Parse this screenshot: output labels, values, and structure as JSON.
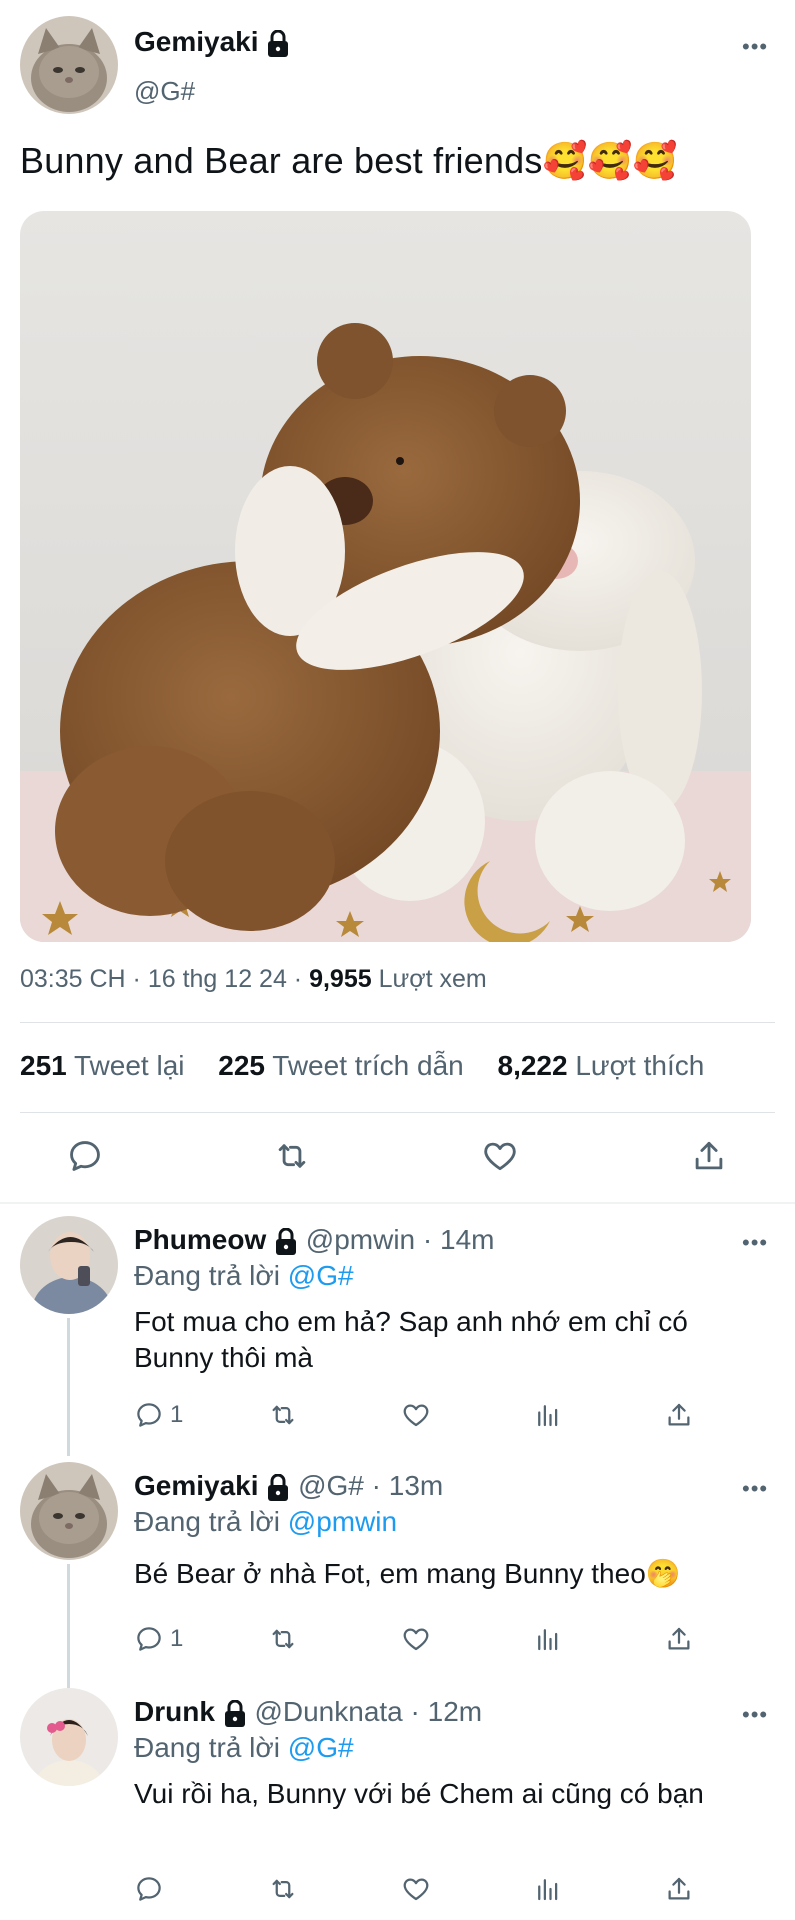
{
  "tweet": {
    "author_name": "Gemiyaki",
    "author_handle": "@G#",
    "text": "Bunny and Bear are best friends🥰🥰🥰",
    "time": "03:35 CH · 16 thg 12 24 · ",
    "views_count": "9,955",
    "views_label": " Lượt xem",
    "stats": {
      "retweets_count": "251",
      "retweets_label": "Tweet lại",
      "quotes_count": "225",
      "quotes_label": "Tweet trích dẫn",
      "likes_count": "8,222",
      "likes_label": "Lượt thích"
    },
    "media_icon": "photo-teddy-bear-hugging-bunny"
  },
  "replies": [
    {
      "author_name": "Phumeow",
      "author_handle": "@pmwin",
      "time": " · 14m",
      "replying_prefix": "Đang trả lời ",
      "replying_to": "@G#",
      "text": "Fot mua cho em hả? Sap anh nhớ em chỉ có Bunny thôi mà",
      "reply_count": "1"
    },
    {
      "author_name": "Gemiyaki",
      "author_handle": "@G#",
      "time": " · 13m",
      "replying_prefix": "Đang trả lời ",
      "replying_to": "@pmwin",
      "text": "Bé Bear ở nhà Fot, em mang Bunny theo🤭",
      "reply_count": "1"
    },
    {
      "author_name": "Drunk",
      "author_handle": "@Dunknata",
      "time": " · 12m",
      "replying_prefix": "Đang trả lời ",
      "replying_to": "@G#",
      "text": "Vui rồi ha, Bunny với bé Chem ai cũng có bạn",
      "reply_count": ""
    }
  ],
  "colors": {
    "accent": "#1d9bf0",
    "secondary_text": "#536471",
    "primary_text": "#0f1419"
  },
  "icons": [
    "more-icon",
    "lock-icon",
    "reply-icon",
    "retweet-icon",
    "like-icon",
    "share-icon",
    "views-icon"
  ]
}
